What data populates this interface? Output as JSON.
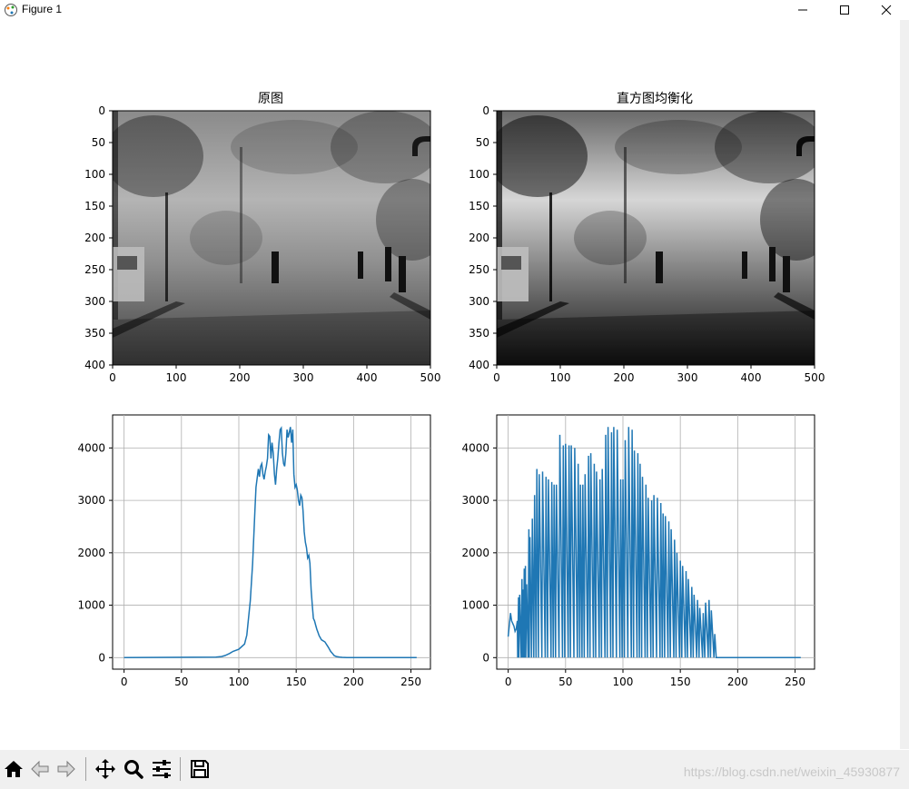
{
  "window": {
    "title": "Figure 1"
  },
  "figure": {
    "left": {
      "title": "原图",
      "image": {
        "x_ticks": [
          "0",
          "100",
          "200",
          "300",
          "400",
          "500"
        ],
        "y_ticks": [
          "0",
          "50",
          "100",
          "150",
          "200",
          "250",
          "300",
          "350",
          "400"
        ]
      },
      "hist": {
        "x_ticks": [
          "0",
          "50",
          "100",
          "150",
          "200",
          "250"
        ],
        "y_ticks": [
          "0",
          "1000",
          "2000",
          "3000",
          "4000"
        ]
      }
    },
    "right": {
      "title": "直方图均衡化",
      "image": {
        "x_ticks": [
          "0",
          "100",
          "200",
          "300",
          "400",
          "500"
        ],
        "y_ticks": [
          "0",
          "50",
          "100",
          "150",
          "200",
          "250",
          "300",
          "350",
          "400"
        ]
      },
      "hist": {
        "x_ticks": [
          "0",
          "50",
          "100",
          "150",
          "200",
          "250"
        ],
        "y_ticks": [
          "0",
          "1000",
          "2000",
          "3000",
          "4000"
        ]
      }
    }
  },
  "chart_data": [
    {
      "type": "line",
      "color": "#1f77b4",
      "grid": true,
      "xlim": [
        -10,
        267
      ],
      "ylim": [
        -220,
        4630
      ],
      "x": [
        0,
        80,
        85,
        88,
        92,
        95,
        100,
        105,
        107,
        110,
        112,
        114,
        115,
        117,
        118,
        119,
        120,
        121,
        122,
        123,
        124,
        125,
        126,
        127,
        128,
        129,
        130,
        131,
        132,
        133,
        134,
        135,
        136,
        137,
        138,
        139,
        140,
        141,
        142,
        143,
        144,
        145,
        146,
        147,
        148,
        149,
        150,
        151,
        152,
        153,
        154,
        155,
        156,
        157,
        158,
        159,
        160,
        161,
        162,
        163,
        164,
        165,
        166,
        167,
        168,
        169,
        170,
        171,
        172,
        175,
        178,
        180,
        182,
        183,
        185,
        188,
        190,
        195,
        200,
        255
      ],
      "y": [
        0,
        10,
        20,
        40,
        80,
        120,
        160,
        260,
        430,
        1080,
        1800,
        2800,
        3250,
        3600,
        3450,
        3650,
        3700,
        3500,
        3400,
        3550,
        3650,
        3800,
        4250,
        4220,
        3800,
        4100,
        3900,
        3500,
        3300,
        3600,
        3800,
        4100,
        4350,
        4380,
        3900,
        3700,
        3650,
        3900,
        4350,
        4200,
        4300,
        4400,
        4100,
        4350,
        3500,
        3250,
        3300,
        3200,
        3000,
        2900,
        3100,
        3050,
        2800,
        2400,
        2200,
        2100,
        1900,
        1950,
        1800,
        1300,
        1000,
        750,
        700,
        620,
        540,
        480,
        420,
        380,
        340,
        300,
        200,
        120,
        70,
        40,
        20,
        10,
        5,
        0,
        0,
        0
      ]
    },
    {
      "type": "line",
      "color": "#1f77b4",
      "grid": true,
      "xlim": [
        -10,
        267
      ],
      "ylim": [
        -220,
        4630
      ],
      "spikes_x": [
        0,
        2,
        3,
        5,
        6,
        7,
        8,
        9,
        10,
        12,
        13,
        14,
        15,
        16,
        18,
        19,
        21,
        23,
        25,
        27,
        30,
        33,
        35,
        38,
        40,
        42,
        45,
        48,
        50,
        53,
        55,
        58,
        61,
        63,
        65,
        67,
        70,
        72,
        75,
        77,
        80,
        82,
        85,
        87,
        90,
        92,
        95,
        98,
        100,
        102,
        105,
        108,
        110,
        113,
        115,
        117,
        120,
        122,
        125,
        127,
        130,
        133,
        135,
        137,
        140,
        142,
        145,
        147,
        150,
        152,
        155,
        157,
        160,
        162,
        165,
        167,
        170,
        172,
        175,
        177,
        180,
        182,
        185,
        187,
        190,
        193,
        195,
        198,
        200,
        202,
        205,
        207,
        210,
        212,
        215,
        217,
        220,
        222,
        225,
        227,
        230,
        232,
        235,
        237,
        240,
        242,
        245,
        247,
        250,
        252,
        253,
        255
      ],
      "spikes_y": [
        400,
        850,
        700,
        600,
        500,
        550,
        700,
        1150,
        1200,
        1500,
        1300,
        1700,
        1750,
        1400,
        2450,
        2300,
        2650,
        3100,
        3600,
        3500,
        3550,
        3450,
        3400,
        3350,
        3300,
        3300,
        4250,
        4050,
        4080,
        4050,
        4050,
        4000,
        3700,
        3300,
        3300,
        3500,
        3850,
        3900,
        3700,
        3550,
        3400,
        3600,
        4250,
        4400,
        4300,
        4400,
        4350,
        3400,
        3400,
        4150,
        4400,
        4350,
        3950,
        3900,
        3700,
        3450,
        3300,
        3050,
        3000,
        3100,
        3050,
        2950,
        2750,
        2700,
        2600,
        2450,
        2250,
        2000,
        1850,
        1750,
        1650,
        1500,
        1350,
        1200,
        1100,
        950,
        850,
        1050,
        1100,
        900,
        450,
        0,
        0,
        0,
        0,
        0,
        0,
        0,
        0,
        0,
        0,
        0,
        0,
        0,
        0,
        0,
        0,
        0,
        0,
        0,
        0,
        0,
        0,
        0,
        0,
        0,
        0,
        0,
        0,
        0,
        0,
        0
      ]
    }
  ],
  "toolbar": {
    "buttons": [
      "home-icon",
      "back-icon",
      "forward-icon",
      "pan-icon",
      "zoom-icon",
      "configure-icon",
      "save-icon"
    ],
    "watermark": "https://blog.csdn.net/weixin_45930877"
  }
}
